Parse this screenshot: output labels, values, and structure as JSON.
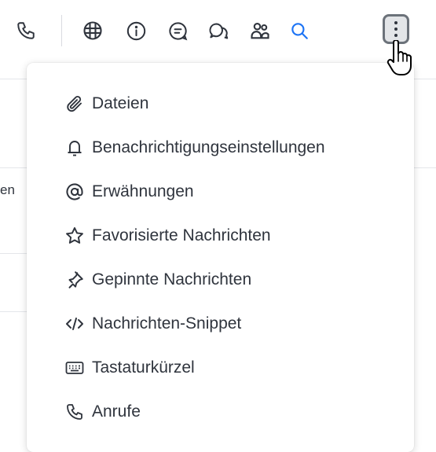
{
  "toolbar": {
    "buttons": [
      {
        "icon": "phone-icon"
      },
      {
        "icon": "team-channels-icon"
      },
      {
        "icon": "info-icon"
      },
      {
        "icon": "threads-icon"
      },
      {
        "icon": "discussion-icon"
      },
      {
        "icon": "members-icon"
      },
      {
        "icon": "search-icon",
        "color": "#1d74f5"
      },
      {
        "icon": "kebab-menu-icon"
      }
    ]
  },
  "background": {
    "partial_text": "en"
  },
  "menu": {
    "items": [
      {
        "label": "Dateien",
        "icon": "paperclip-icon"
      },
      {
        "label": "Benachrichtigungseinstellungen",
        "icon": "bell-icon"
      },
      {
        "label": "Erwähnungen",
        "icon": "at-icon"
      },
      {
        "label": "Favorisierte Nachrichten",
        "icon": "star-icon"
      },
      {
        "label": "Gepinnte Nachrichten",
        "icon": "pin-icon"
      },
      {
        "label": "Nachrichten-Snippet",
        "icon": "code-icon"
      },
      {
        "label": "Tastaturkürzel",
        "icon": "keyboard-icon"
      },
      {
        "label": "Anrufe",
        "icon": "phone-icon"
      }
    ]
  },
  "colors": {
    "icon": "#2f343d",
    "accent": "#1d74f5",
    "menu_bg": "#ffffff"
  }
}
